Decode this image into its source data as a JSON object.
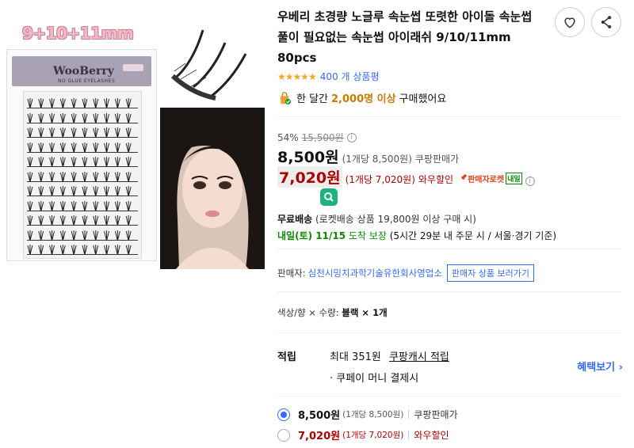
{
  "gallery": {
    "size_label": "9+10+11mm",
    "brand": "WooBerry",
    "brand_sub": "NO GLUE EYELASHES"
  },
  "product": {
    "title": "우베리 초경량 노글루 속눈썹 또렷한 아이돌 속눈썹 풀이 필요없는 속눈썹 아이래쉬 9/10/11mm 80pcs",
    "rating_stars": "★★★★★",
    "review_count": "400 개 상품평",
    "bought_prefix": "한 달간",
    "bought_count": "2,000명 이상",
    "bought_suffix": "구매했어요"
  },
  "pricing": {
    "discount": "54%",
    "original_price": "15,500원",
    "price": "8,500원",
    "price_unit": "(1개당 8,500원)",
    "price_seller_type": "쿠팡판매가",
    "wow_price": "7,020원",
    "wow_unit": "(1개당 7,020원)",
    "wow_label": "와우할인",
    "rocket_label": "판매자로켓",
    "tomorrow_tag": "내일"
  },
  "shipping": {
    "free_label": "무료배송",
    "free_condition": "(로켓배송 상품 19,800원 이상 구매 시)",
    "arrival_date": "내일(토) 11/15",
    "arrival_guarantee": "도착 보장",
    "arrival_condition": "(5시간 29분 내 주문 시 / 서울·경기 기준)"
  },
  "seller": {
    "label": "판매자:",
    "name": "심천시밍치과학기술유한회사영업소",
    "button": "판매자 상품 보러가기"
  },
  "option": {
    "label": "색상/향 × 수량:",
    "value": "블랙 × 1개"
  },
  "reward": {
    "label": "적립",
    "max_text": "최대 351원",
    "cash_label": "쿠팡캐시 적립",
    "pay_text": "· 쿠페이 머니 결제시",
    "benefit_link": "혜택보기 ›"
  },
  "price_options": [
    {
      "price": "8,500원",
      "unit": "(1개당 8,500원)",
      "type": "쿠팡판매가",
      "selected": true
    },
    {
      "price": "7,020원",
      "unit": "(1개당 7,020원)",
      "type": "와우할인",
      "selected": false
    }
  ],
  "colors": {
    "accent_blue": "#346aff",
    "wow_red": "#ae0000",
    "star_orange": "#f5a623",
    "arrival_green": "#0a8a00"
  },
  "icons": [
    "heart-icon",
    "share-icon",
    "bag-icon",
    "info-icon",
    "rocket-icon",
    "q-badge-icon"
  ]
}
